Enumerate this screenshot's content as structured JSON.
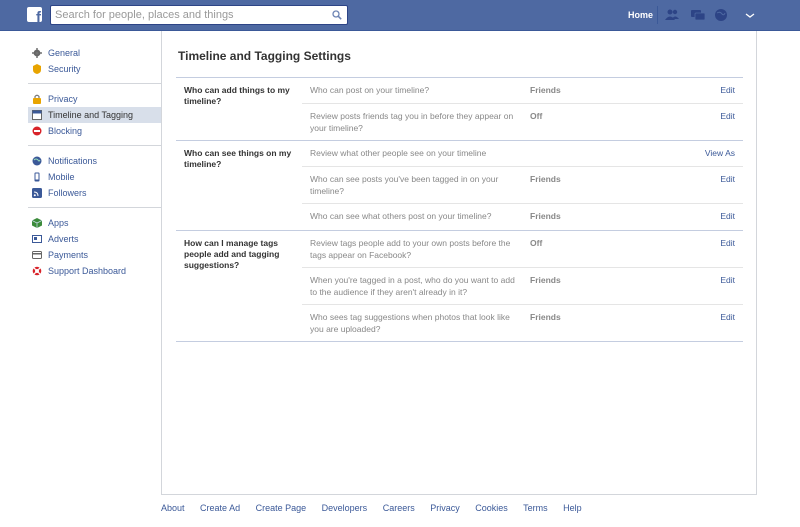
{
  "topbar": {
    "search_placeholder": "Search for people, places and things",
    "home_label": "Home",
    "icons": [
      "friend-requests-icon",
      "messages-icon",
      "notifications-globe-icon",
      "account-menu-chevron-icon"
    ]
  },
  "sidebar": {
    "groups": [
      [
        {
          "label": "General",
          "icon": "gear-icon"
        },
        {
          "label": "Security",
          "icon": "badge-icon"
        }
      ],
      [
        {
          "label": "Privacy",
          "icon": "lock-icon"
        },
        {
          "label": "Timeline and Tagging",
          "icon": "timeline-icon",
          "active": true
        },
        {
          "label": "Blocking",
          "icon": "block-icon"
        }
      ],
      [
        {
          "label": "Notifications",
          "icon": "globe-icon"
        },
        {
          "label": "Mobile",
          "icon": "mobile-icon"
        },
        {
          "label": "Followers",
          "icon": "rss-icon"
        }
      ],
      [
        {
          "label": "Apps",
          "icon": "cube-icon"
        },
        {
          "label": "Adverts",
          "icon": "adverts-icon"
        },
        {
          "label": "Payments",
          "icon": "card-icon"
        },
        {
          "label": "Support Dashboard",
          "icon": "lifebuoy-icon"
        }
      ]
    ]
  },
  "main": {
    "title": "Timeline and Tagging Settings",
    "sections": [
      {
        "label": "Who can add things to my timeline?",
        "rows": [
          {
            "question": "Who can post on your timeline?",
            "value": "Friends",
            "action": "Edit"
          },
          {
            "question": "Review posts friends tag you in before they appear on your timeline?",
            "value": "Off",
            "action": "Edit"
          }
        ]
      },
      {
        "label": "Who can see things on my timeline?",
        "rows": [
          {
            "question": "Review what other people see on your timeline",
            "value": "",
            "action": "View As"
          },
          {
            "question": "Who can see posts you've been tagged in on your timeline?",
            "value": "Friends",
            "action": "Edit"
          },
          {
            "question": "Who can see what others post on your timeline?",
            "value": "Friends",
            "action": "Edit"
          }
        ]
      },
      {
        "label": "How can I manage tags people add and tagging suggestions?",
        "rows": [
          {
            "question": "Review tags people add to your own posts before the tags appear on Facebook?",
            "value": "Off",
            "action": "Edit"
          },
          {
            "question": "When you're tagged in a post, who do you want to add to the audience if they aren't already in it?",
            "value": "Friends",
            "action": "Edit"
          },
          {
            "question": "Who sees tag suggestions when photos that look like you are uploaded?",
            "value": "Friends",
            "action": "Edit"
          }
        ]
      }
    ]
  },
  "footer": {
    "links": [
      "About",
      "Create Ad",
      "Create Page",
      "Developers",
      "Careers",
      "Privacy",
      "Cookies",
      "Terms",
      "Help"
    ]
  }
}
